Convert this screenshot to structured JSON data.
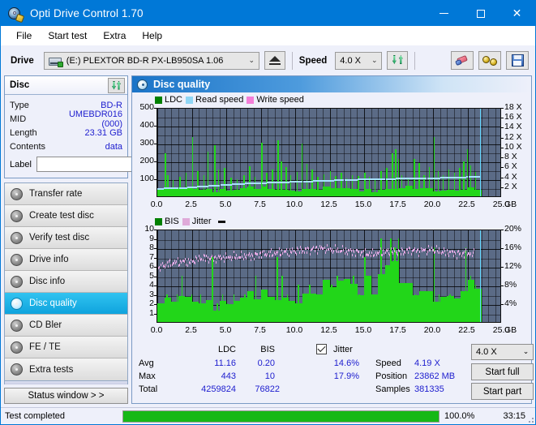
{
  "window": {
    "title": "Opti Drive Control 1.70",
    "app_icon": "disc-tool-icon",
    "minimize": "minimize",
    "maximize": "maximize",
    "close": "close"
  },
  "menu": {
    "items": [
      "File",
      "Start test",
      "Extra",
      "Help"
    ]
  },
  "toolbar": {
    "drive_label": "Drive",
    "drive_value": "(E:)   PLEXTOR BD-R  PX-LB950SA 1.06",
    "eject_icon": "eject-icon",
    "speed_label": "Speed",
    "speed_value": "4.0 X",
    "refresh_icon": "refresh-icon",
    "erase_icon": "eraser-icon",
    "gold_icon": "gold-discs-icon",
    "save_icon": "save-floppy-icon",
    "chevron": "⌄"
  },
  "disc_panel": {
    "title": "Disc",
    "refresh_icon": "refresh-icon",
    "rows": [
      {
        "key": "Type",
        "value": "BD-R"
      },
      {
        "key": "MID",
        "value": "UMEBDR016 (000)"
      },
      {
        "key": "Length",
        "value": "23.31 GB"
      },
      {
        "key": "Contents",
        "value": "data"
      }
    ],
    "label_key": "Label",
    "label_value": "",
    "label_placeholder": "",
    "disc_icon": "cd-disc-icon"
  },
  "nav": {
    "items": [
      {
        "label": "Transfer rate",
        "icon": "disc-transfer-icon",
        "active": false
      },
      {
        "label": "Create test disc",
        "icon": "disc-create-icon",
        "active": false
      },
      {
        "label": "Verify test disc",
        "icon": "disc-verify-icon",
        "active": false
      },
      {
        "label": "Drive info",
        "icon": "disc-drive-icon",
        "active": false
      },
      {
        "label": "Disc info",
        "icon": "disc-info-icon",
        "active": false
      },
      {
        "label": "Disc quality",
        "icon": "disc-quality-icon",
        "active": true
      },
      {
        "label": "CD Bler",
        "icon": "disc-bler-icon",
        "active": false
      },
      {
        "label": "FE / TE",
        "icon": "disc-fete-icon",
        "active": false
      },
      {
        "label": "Extra tests",
        "icon": "disc-extra-icon",
        "active": false
      }
    ],
    "status_window": "Status window > >"
  },
  "content": {
    "header": "Disc quality",
    "header_icon": "disc-quality-icon"
  },
  "chart_data": [
    {
      "type": "bar",
      "title": "",
      "xlabel": "GB",
      "ylabel": "",
      "xlim": [
        0,
        25
      ],
      "ylim": [
        0,
        500
      ],
      "y2lim": [
        0,
        18
      ],
      "y2label": "X",
      "grid": true,
      "legend_position": "top-left",
      "legend": [
        {
          "name": "LDC",
          "color": "#008000"
        },
        {
          "name": "Read speed",
          "color": "#8fd6f5"
        },
        {
          "name": "Write speed",
          "color": "#f47fd8"
        }
      ],
      "xticks": [
        "0.0",
        "2.5",
        "5.0",
        "7.5",
        "10.0",
        "12.5",
        "15.0",
        "17.5",
        "20.0",
        "22.5",
        "25.0"
      ],
      "yticks": [
        "100",
        "200",
        "300",
        "400",
        "500"
      ],
      "y2ticks": [
        "2 X",
        "4 X",
        "6 X",
        "8 X",
        "10 X",
        "12 X",
        "14 X",
        "16 X",
        "18 X"
      ],
      "xunit": "GB",
      "series": [
        {
          "name": "LDC",
          "color": "#22d619",
          "x_max_gb": 23.4,
          "baseline": 40,
          "spikes": [
            [
              0.55,
              240
            ],
            [
              0.72,
              120
            ],
            [
              1.1,
              90
            ],
            [
              1.6,
              110
            ],
            [
              2.05,
              130
            ],
            [
              2.52,
              330
            ],
            [
              2.9,
              140
            ],
            [
              3.35,
              120
            ],
            [
              3.62,
              250
            ],
            [
              4.12,
              285
            ],
            [
              4.4,
              150
            ],
            [
              4.85,
              160
            ],
            [
              5.3,
              105
            ],
            [
              5.75,
              95
            ],
            [
              6.25,
              120
            ],
            [
              6.65,
              170
            ],
            [
              7.05,
              110
            ],
            [
              7.55,
              300
            ],
            [
              7.9,
              130
            ],
            [
              8.3,
              150
            ],
            [
              8.72,
              315
            ],
            [
              8.95,
              195
            ],
            [
              9.3,
              165
            ],
            [
              9.62,
              120
            ],
            [
              10.1,
              135
            ],
            [
              10.45,
              295
            ],
            [
              10.8,
              180
            ],
            [
              11.2,
              150
            ],
            [
              11.6,
              110
            ],
            [
              12.05,
              125
            ],
            [
              12.5,
              140
            ],
            [
              12.9,
              115
            ],
            [
              13.3,
              130
            ],
            [
              13.7,
              100
            ],
            [
              14.1,
              120
            ],
            [
              14.55,
              115
            ],
            [
              15.0,
              130
            ],
            [
              15.35,
              110
            ],
            [
              15.75,
              95
            ],
            [
              16.2,
              140
            ],
            [
              16.6,
              160
            ],
            [
              17.0,
              240
            ],
            [
              17.25,
              265
            ],
            [
              17.45,
              210
            ],
            [
              17.7,
              120
            ],
            [
              18.15,
              95
            ],
            [
              18.6,
              210
            ],
            [
              18.95,
              185
            ],
            [
              19.3,
              120
            ],
            [
              19.7,
              165
            ],
            [
              20.05,
              330
            ],
            [
              20.35,
              140
            ],
            [
              20.7,
              120
            ],
            [
              21.1,
              150
            ],
            [
              21.5,
              130
            ],
            [
              21.9,
              160
            ],
            [
              22.2,
              195
            ],
            [
              22.45,
              265
            ],
            [
              22.7,
              175
            ],
            [
              23.05,
              135
            ]
          ]
        },
        {
          "name": "Read speed",
          "color": "#a7e1ff",
          "points": [
            [
              0.0,
              2.0
            ],
            [
              1.0,
              2.1
            ],
            [
              2.0,
              2.2
            ],
            [
              3.0,
              2.4
            ],
            [
              4.0,
              2.6
            ],
            [
              5.0,
              2.8
            ],
            [
              6.0,
              3.0
            ],
            [
              7.0,
              3.1
            ],
            [
              8.0,
              3.2
            ],
            [
              9.0,
              3.3
            ],
            [
              10.0,
              3.4
            ],
            [
              11.0,
              3.5
            ],
            [
              12.0,
              3.6
            ],
            [
              13.0,
              3.7
            ],
            [
              14.0,
              3.8
            ],
            [
              15.0,
              3.9
            ],
            [
              16.0,
              4.0
            ],
            [
              17.0,
              4.0
            ],
            [
              18.0,
              4.05
            ],
            [
              19.0,
              4.1
            ],
            [
              20.0,
              4.15
            ],
            [
              21.0,
              4.2
            ],
            [
              22.0,
              4.3
            ],
            [
              23.0,
              4.4
            ],
            [
              23.4,
              4.5
            ]
          ]
        }
      ],
      "cursor_gb": 23.4
    },
    {
      "type": "bar",
      "title": "",
      "xlabel": "GB",
      "ylabel": "",
      "xlim": [
        0,
        25
      ],
      "ylim": [
        0,
        10
      ],
      "y2lim": [
        0,
        20
      ],
      "y2label": "%",
      "grid": true,
      "legend_position": "top-left",
      "legend": [
        {
          "name": "BIS",
          "color": "#008000"
        },
        {
          "name": "Jitter",
          "color": "#dfaad9"
        }
      ],
      "xticks": [
        "0.0",
        "2.5",
        "5.0",
        "7.5",
        "10.0",
        "12.5",
        "15.0",
        "17.5",
        "20.0",
        "22.5",
        "25.0"
      ],
      "yticks": [
        "1",
        "2",
        "3",
        "4",
        "5",
        "6",
        "7",
        "8",
        "9",
        "10"
      ],
      "y2ticks": [
        "4%",
        "8%",
        "12%",
        "16%",
        "20%"
      ],
      "xunit": "GB",
      "series": [
        {
          "name": "BIS",
          "color": "#22d619",
          "x_max_gb": 23.4,
          "baseline": 1.0,
          "spikes": [
            [
              0.3,
              2
            ],
            [
              0.65,
              3
            ],
            [
              1.05,
              2
            ],
            [
              1.4,
              3
            ],
            [
              1.75,
              5
            ],
            [
              2.1,
              2
            ],
            [
              2.45,
              3
            ],
            [
              2.8,
              2
            ],
            [
              3.1,
              3
            ],
            [
              3.45,
              2
            ],
            [
              3.95,
              7
            ],
            [
              4.3,
              2
            ],
            [
              4.7,
              3
            ],
            [
              5.05,
              2
            ],
            [
              5.5,
              3
            ],
            [
              5.9,
              2
            ],
            [
              6.3,
              3
            ],
            [
              6.7,
              2
            ],
            [
              7.1,
              5
            ],
            [
              7.5,
              2
            ],
            [
              7.9,
              3
            ],
            [
              8.3,
              2
            ],
            [
              8.65,
              7
            ],
            [
              9.0,
              5
            ],
            [
              9.4,
              3
            ],
            [
              9.8,
              2
            ],
            [
              10.2,
              4
            ],
            [
              10.6,
              3
            ],
            [
              11.0,
              4
            ],
            [
              11.4,
              2
            ],
            [
              11.8,
              3
            ],
            [
              12.2,
              2
            ],
            [
              12.6,
              4
            ],
            [
              13.0,
              5
            ],
            [
              13.4,
              4
            ],
            [
              13.8,
              3
            ],
            [
              14.2,
              5
            ],
            [
              14.6,
              3
            ],
            [
              15.0,
              7
            ],
            [
              15.4,
              4
            ],
            [
              15.8,
              3
            ],
            [
              16.2,
              9
            ],
            [
              16.5,
              5
            ],
            [
              16.9,
              9
            ],
            [
              17.2,
              8
            ],
            [
              17.45,
              9
            ],
            [
              17.9,
              3
            ],
            [
              18.3,
              2
            ],
            [
              18.7,
              3
            ],
            [
              19.1,
              2
            ],
            [
              19.6,
              3
            ],
            [
              20.05,
              8
            ],
            [
              20.4,
              3
            ],
            [
              20.8,
              2
            ],
            [
              21.2,
              3
            ],
            [
              21.6,
              2
            ],
            [
              22.0,
              3
            ],
            [
              22.35,
              8
            ],
            [
              22.7,
              5
            ],
            [
              23.05,
              4
            ]
          ],
          "fill_profile": [
            [
              0.0,
              2.0
            ],
            [
              2.0,
              2.2
            ],
            [
              4.0,
              2.3
            ],
            [
              6.0,
              2.4
            ],
            [
              8.0,
              2.6
            ],
            [
              10.0,
              3.0
            ],
            [
              12.0,
              3.2
            ],
            [
              13.5,
              4.0
            ],
            [
              14.5,
              4.3
            ],
            [
              15.5,
              5.2
            ],
            [
              16.5,
              6.0
            ],
            [
              17.2,
              6.2
            ],
            [
              17.6,
              3.0
            ],
            [
              18.5,
              2.8
            ],
            [
              19.5,
              3.0
            ],
            [
              20.5,
              3.2
            ],
            [
              21.5,
              3.4
            ],
            [
              22.5,
              3.6
            ],
            [
              23.4,
              4.0
            ]
          ]
        },
        {
          "name": "Jitter",
          "color": "#e3a8e3",
          "points": [
            [
              0.05,
              5.9
            ],
            [
              0.4,
              6.3
            ],
            [
              0.9,
              6.5
            ],
            [
              1.4,
              6.6
            ],
            [
              1.9,
              6.7
            ],
            [
              2.4,
              6.6
            ],
            [
              2.9,
              7.0
            ],
            [
              3.4,
              7.1
            ],
            [
              3.9,
              7.0
            ],
            [
              4.4,
              7.1
            ],
            [
              4.9,
              7.1
            ],
            [
              5.4,
              7.2
            ],
            [
              5.9,
              7.2
            ],
            [
              6.4,
              7.3
            ],
            [
              6.9,
              7.3
            ],
            [
              7.4,
              7.5
            ],
            [
              7.9,
              7.5
            ],
            [
              8.4,
              7.6
            ],
            [
              8.9,
              7.7
            ],
            [
              9.4,
              7.7
            ],
            [
              9.9,
              7.8
            ],
            [
              10.4,
              7.9
            ],
            [
              10.9,
              7.9
            ],
            [
              11.4,
              8.0
            ],
            [
              11.9,
              8.1
            ],
            [
              12.4,
              8.0
            ],
            [
              12.9,
              7.9
            ],
            [
              13.4,
              7.9
            ],
            [
              13.9,
              7.8
            ],
            [
              14.4,
              7.7
            ],
            [
              14.9,
              7.6
            ],
            [
              15.4,
              7.5
            ],
            [
              15.9,
              7.6
            ],
            [
              16.4,
              7.7
            ],
            [
              16.9,
              7.8
            ],
            [
              17.4,
              7.7
            ],
            [
              17.9,
              7.8
            ],
            [
              18.4,
              7.9
            ],
            [
              18.9,
              7.8
            ],
            [
              19.4,
              7.9
            ],
            [
              19.9,
              8.0
            ],
            [
              20.4,
              7.8
            ],
            [
              20.9,
              7.7
            ],
            [
              21.4,
              7.6
            ],
            [
              21.9,
              7.5
            ],
            [
              22.4,
              7.6
            ],
            [
              22.9,
              7.5
            ]
          ]
        }
      ],
      "cursor_gb": 23.4
    }
  ],
  "results": {
    "col_ldc": "LDC",
    "col_bis": "BIS",
    "jitter_label": "Jitter",
    "jitter_checked": true,
    "rows": [
      {
        "key": "Avg",
        "ldc": "11.16",
        "bis": "0.20",
        "jitter": "14.6%"
      },
      {
        "key": "Max",
        "ldc": "443",
        "bis": "10",
        "jitter": "17.9%"
      },
      {
        "key": "Total",
        "ldc": "4259824",
        "bis": "76822",
        "jitter": ""
      }
    ],
    "speed_label": "Speed",
    "speed_value": "4.19 X",
    "position_label": "Position",
    "position_value": "23862 MB",
    "samples_label": "Samples",
    "samples_value": "381335",
    "speed_select": "4.0 X",
    "start_full": "Start full",
    "start_part": "Start part"
  },
  "statusbar": {
    "text": "Test completed",
    "percent_text": "100.0%",
    "percent": 100,
    "elapsed": "33:15",
    "progress_color": "#16b816"
  }
}
